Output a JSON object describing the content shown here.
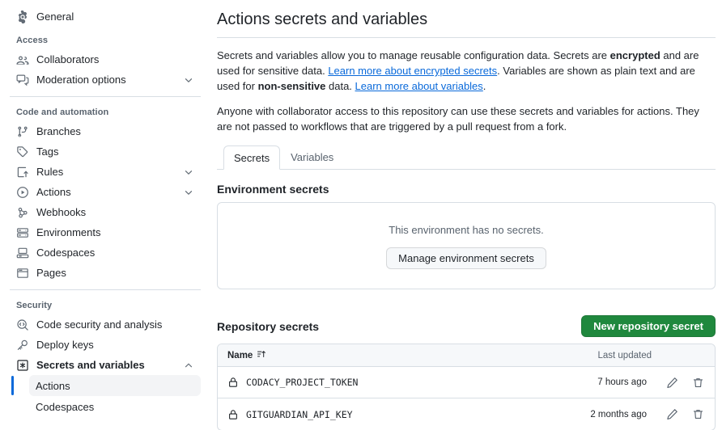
{
  "sidebar": {
    "top_items": [
      {
        "label": "General",
        "icon": "gear-icon"
      }
    ],
    "sections": [
      {
        "title": "Access",
        "items": [
          {
            "label": "Collaborators",
            "icon": "people-icon",
            "chevron": false
          },
          {
            "label": "Moderation options",
            "icon": "comment-discussion-icon",
            "chevron": true
          }
        ]
      },
      {
        "title": "Code and automation",
        "items": [
          {
            "label": "Branches",
            "icon": "git-branch-icon",
            "chevron": false
          },
          {
            "label": "Tags",
            "icon": "tag-icon",
            "chevron": false
          },
          {
            "label": "Rules",
            "icon": "rules-icon",
            "chevron": true
          },
          {
            "label": "Actions",
            "icon": "play-circle-icon",
            "chevron": true
          },
          {
            "label": "Webhooks",
            "icon": "webhook-icon",
            "chevron": false
          },
          {
            "label": "Environments",
            "icon": "server-icon",
            "chevron": false
          },
          {
            "label": "Codespaces",
            "icon": "codespaces-icon",
            "chevron": false
          },
          {
            "label": "Pages",
            "icon": "browser-icon",
            "chevron": false
          }
        ]
      },
      {
        "title": "Security",
        "items": [
          {
            "label": "Code security and analysis",
            "icon": "codescan-icon",
            "chevron": false
          },
          {
            "label": "Deploy keys",
            "icon": "key-icon",
            "chevron": false
          },
          {
            "label": "Secrets and variables",
            "icon": "asterisk-box-icon",
            "chevron": true,
            "expanded": true,
            "bold": true
          }
        ]
      }
    ],
    "sub_items": [
      {
        "label": "Actions",
        "selected": true
      },
      {
        "label": "Codespaces",
        "selected": false
      }
    ]
  },
  "main": {
    "title": "Actions secrets and variables",
    "intro": {
      "part1": "Secrets and variables allow you to manage reusable configuration data. Secrets are ",
      "bold1": "encrypted",
      "part2": " and are used for sensitive data. ",
      "link1": "Learn more about encrypted secrets",
      "part3": ". Variables are shown as plain text and are used for ",
      "bold2": "non-sensitive",
      "part4": " data. ",
      "link2": "Learn more about variables",
      "part5": "."
    },
    "notice": "Anyone with collaborator access to this repository can use these secrets and variables for actions. They are not passed to workflows that are triggered by a pull request from a fork.",
    "tabs": [
      {
        "label": "Secrets",
        "active": true
      },
      {
        "label": "Variables",
        "active": false
      }
    ],
    "environment_secrets": {
      "title": "Environment secrets",
      "empty_text": "This environment has no secrets.",
      "manage_button": "Manage environment secrets"
    },
    "repository_secrets": {
      "title": "Repository secrets",
      "new_button": "New repository secret",
      "columns": {
        "name": "Name",
        "last_updated": "Last updated"
      },
      "sort_icon": "sort-asc-icon",
      "rows": [
        {
          "name": "CODACY_PROJECT_TOKEN",
          "last_updated": "7 hours ago",
          "lock_icon": "lock-icon",
          "edit_icon": "pencil-icon",
          "delete_icon": "trash-icon"
        },
        {
          "name": "GITGUARDIAN_API_KEY",
          "last_updated": "2 months ago",
          "lock_icon": "lock-icon",
          "edit_icon": "pencil-icon",
          "delete_icon": "trash-icon"
        }
      ]
    }
  },
  "colors": {
    "accent_link": "#0969da",
    "primary_button": "#1f883d",
    "border": "#d8dee4",
    "muted_text": "#59636e"
  }
}
